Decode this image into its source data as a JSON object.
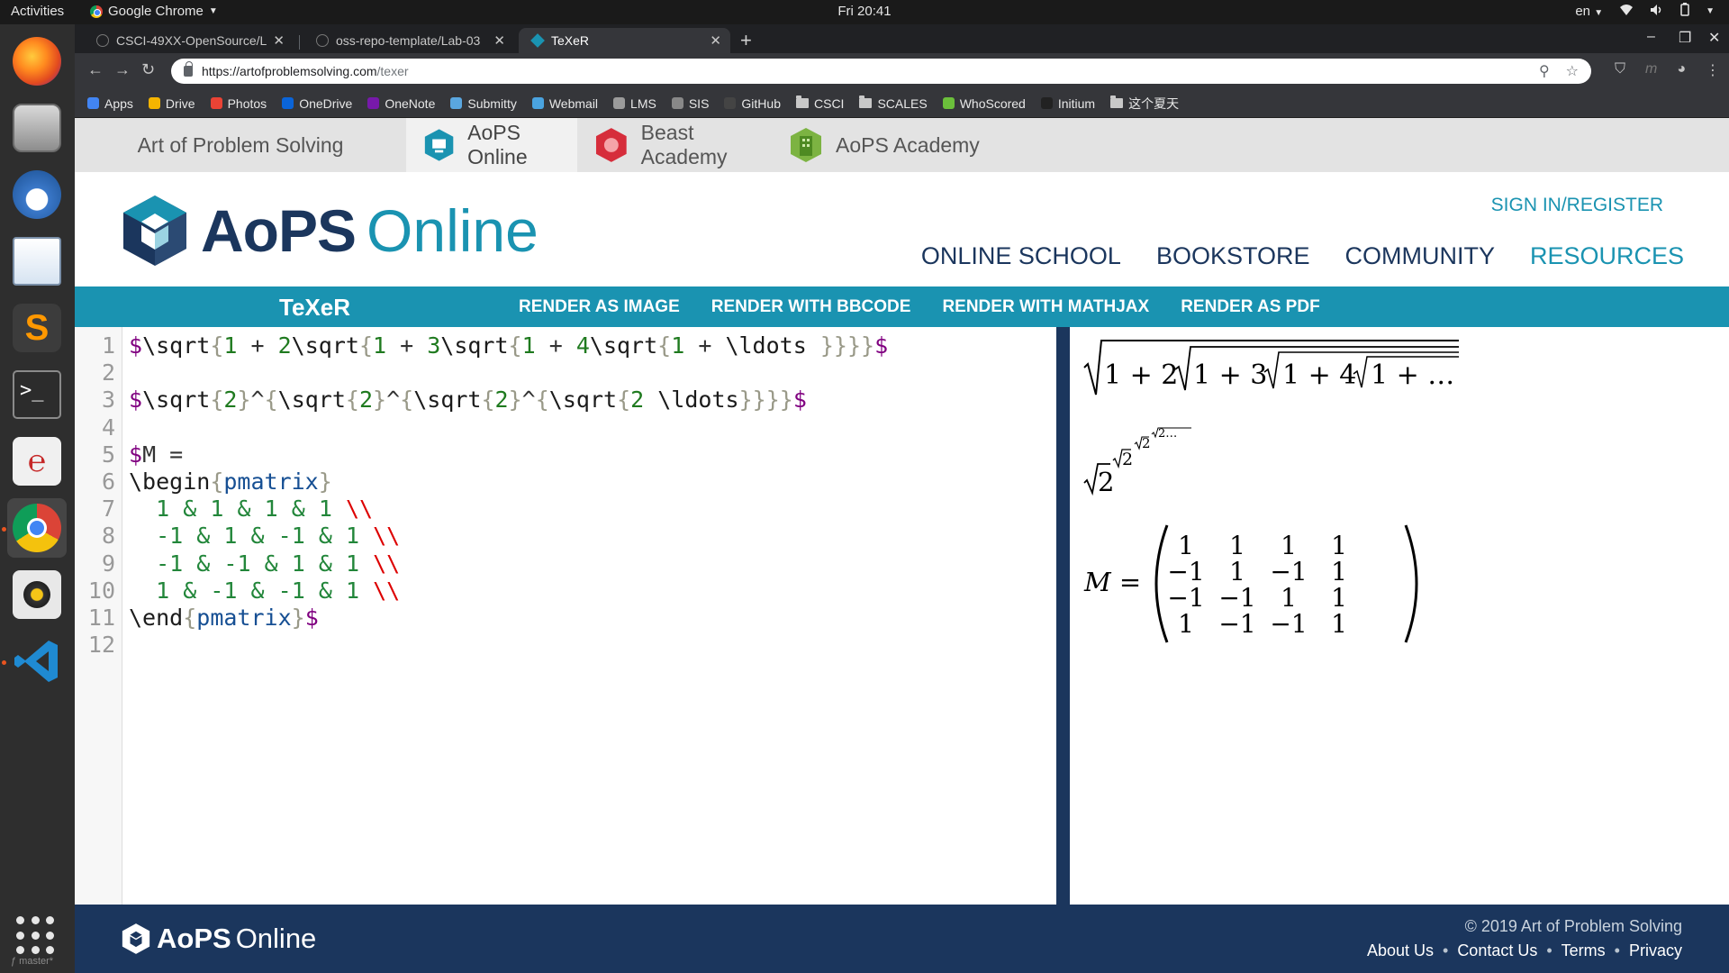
{
  "os": {
    "activities": "Activities",
    "app_menu": "Google Chrome",
    "clock": "Fri 20:41",
    "lang": "en",
    "git_label": "ƒ master*"
  },
  "browser": {
    "tabs": [
      {
        "title": "CSCI-49XX-OpenSource/L"
      },
      {
        "title": "oss-repo-template/Lab-03"
      },
      {
        "title": "TeXeR"
      }
    ],
    "url_host": "https://artofproblemsolving.com",
    "url_path": "/texer",
    "bookmarks": [
      {
        "label": "Apps",
        "color": "#4285f4"
      },
      {
        "label": "Drive",
        "color": "#f4b400"
      },
      {
        "label": "Photos",
        "color": "#ea4335"
      },
      {
        "label": "OneDrive",
        "color": "#0a64d8"
      },
      {
        "label": "OneNote",
        "color": "#7719aa"
      },
      {
        "label": "Submitty",
        "color": "#5aa7e0"
      },
      {
        "label": "Webmail",
        "color": "#4aa3df"
      },
      {
        "label": "LMS",
        "color": "#9b9b9b"
      },
      {
        "label": "SIS",
        "color": "#888888"
      },
      {
        "label": "GitHub",
        "color": "#444444"
      },
      {
        "label": "CSCI",
        "color": "folder"
      },
      {
        "label": "SCALES",
        "color": "folder"
      },
      {
        "label": "WhoScored",
        "color": "#6bbf3b"
      },
      {
        "label": "Initium",
        "color": "#222222"
      },
      {
        "label": "这个夏天",
        "color": "folder"
      }
    ]
  },
  "site": {
    "tabs": [
      {
        "label": "Art of Problem Solving"
      },
      {
        "label": "AoPS Online"
      },
      {
        "label": "Beast Academy"
      },
      {
        "label": "AoPS Academy"
      }
    ],
    "logo_aops": "AoPS",
    "logo_online": "Online",
    "signin": "SIGN IN/REGISTER",
    "nav": [
      {
        "label": "ONLINE SCHOOL"
      },
      {
        "label": "BOOKSTORE"
      },
      {
        "label": "COMMUNITY"
      },
      {
        "label": "RESOURCES"
      }
    ],
    "texer_title": "TeXeR",
    "render_links": [
      {
        "label": "RENDER AS IMAGE"
      },
      {
        "label": "RENDER WITH BBCODE"
      },
      {
        "label": "RENDER WITH MATHJAX"
      },
      {
        "label": "RENDER AS PDF"
      }
    ],
    "footer": {
      "copyright": "© 2019 Art of Problem Solving",
      "links": [
        {
          "label": "About Us"
        },
        {
          "label": "Contact Us"
        },
        {
          "label": "Terms"
        },
        {
          "label": "Privacy"
        }
      ]
    }
  },
  "editor": {
    "line_numbers": [
      "1",
      "2",
      "3",
      "4",
      "5",
      "6",
      "7",
      "8",
      "9",
      "10",
      "11",
      "12"
    ],
    "lines": [
      "$\\sqrt{1 + 2\\sqrt{1 + 3\\sqrt{1 + 4\\sqrt{1 + \\ldots }}}}$",
      "",
      "$\\sqrt{2}^{\\sqrt{2}^{\\sqrt{2}^{\\sqrt{2 \\ldots}}}}$",
      "",
      "$M =",
      "\\begin{pmatrix}",
      "  1 & 1 & 1 & 1 \\\\",
      "  -1 & 1 & -1 & 1 \\\\",
      "  -1 & -1 & 1 & 1 \\\\",
      "  1 & -1 & -1 & 1 \\\\",
      "\\end{pmatrix}$",
      ""
    ]
  },
  "preview": {
    "eq1": [
      "1 + 2",
      "1 + 3",
      "1 + 4",
      "1 + …"
    ],
    "eq2_base": "2",
    "eq2_exp1": "2",
    "eq2_exp2": "2",
    "eq2_exp3": "2…",
    "eq3_label": "M =",
    "matrix": [
      [
        "1",
        "1",
        "1",
        "1"
      ],
      [
        "−1",
        "1",
        "−1",
        "1"
      ],
      [
        "−1",
        "−1",
        "1",
        "1"
      ],
      [
        "1",
        "−1",
        "−1",
        "1"
      ]
    ]
  }
}
